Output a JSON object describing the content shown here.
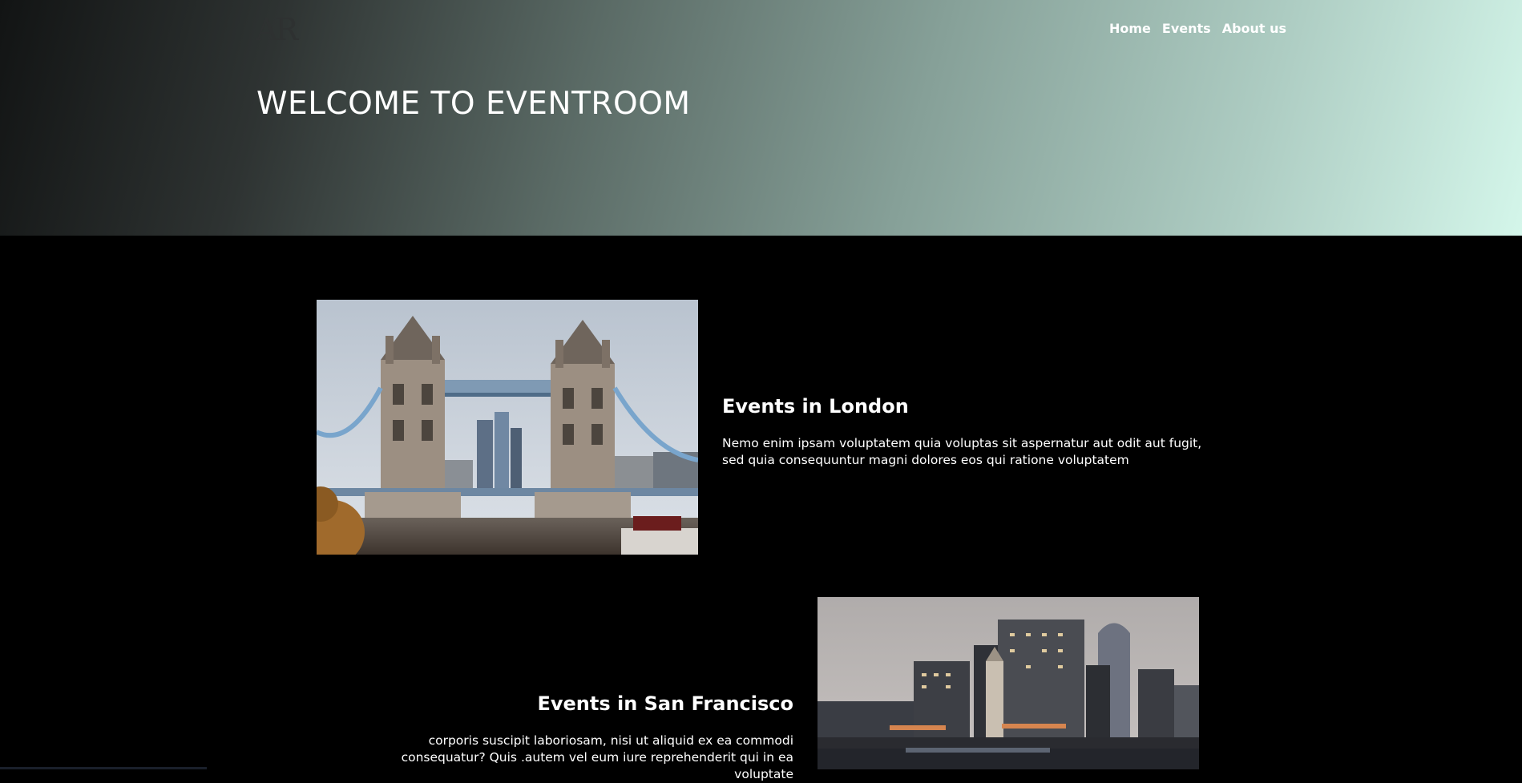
{
  "header": {
    "logo_text": "AR",
    "nav": [
      {
        "label": "Home"
      },
      {
        "label": "Events"
      },
      {
        "label": "About us"
      }
    ],
    "title": "WELCOME TO EVENTROOM"
  },
  "events": [
    {
      "title": "Events in London",
      "description": "Nemo enim ipsam voluptatem quia voluptas sit aspernatur aut odit aut fugit, sed quia consequuntur magni dolores eos qui ratione voluptatem",
      "image": "tower-bridge-photo"
    },
    {
      "title": "Events in San Francisco",
      "description": "corporis suscipit laboriosam, nisi ut aliquid ex ea commodi consequatur? Quis .autem vel eum iure reprehenderit qui in ea voluptate",
      "image": "san-francisco-skyline-photo"
    }
  ],
  "colors": {
    "hero_gradient_start": "#121414",
    "hero_gradient_end": "#d4f6ea",
    "page_background": "#000000",
    "text": "#ffffff"
  }
}
